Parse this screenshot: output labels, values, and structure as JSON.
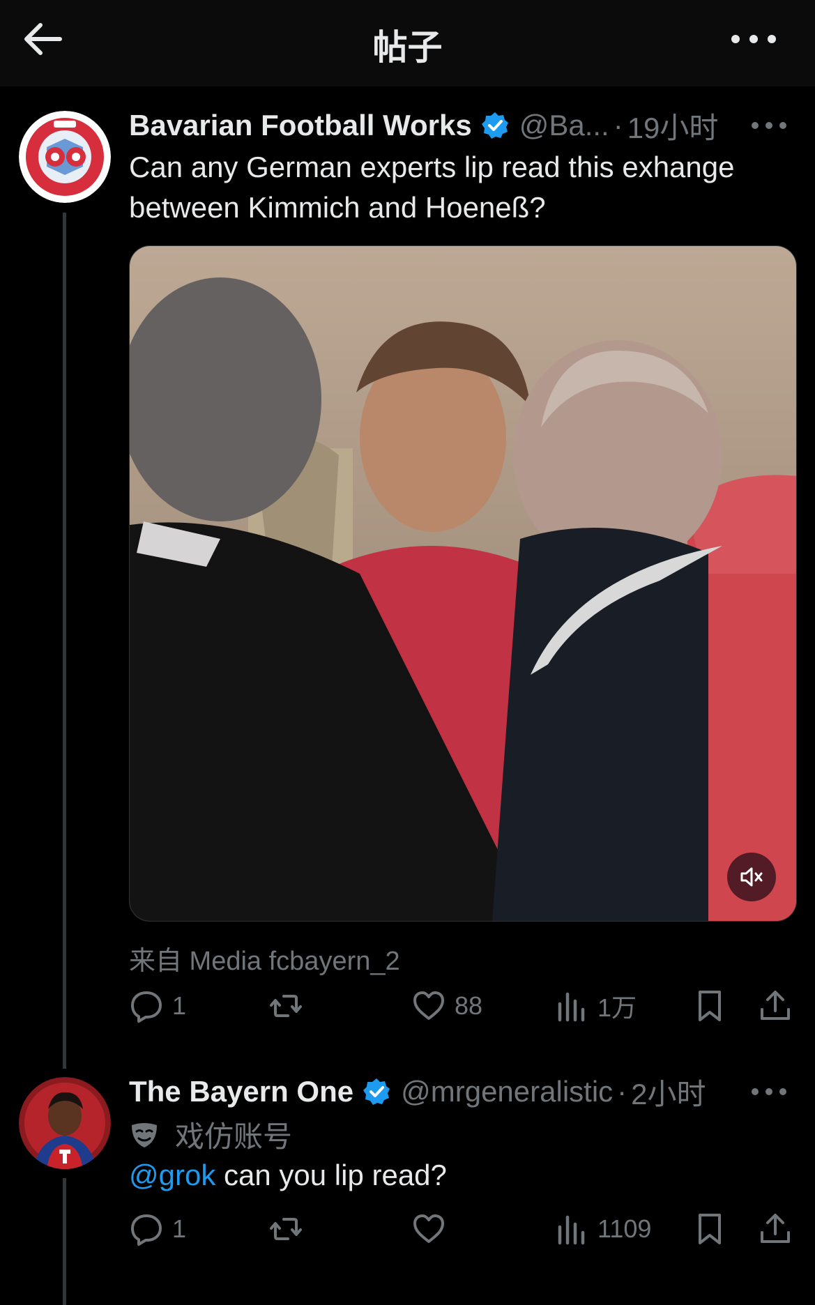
{
  "header": {
    "title": "帖子"
  },
  "main_post": {
    "author_name": "Bavarian Football Works",
    "handle": "@Ba...",
    "separator": "·",
    "time": "19小时",
    "text": "Can any German experts lip read this exhange between Kimmich and Hoeneß?",
    "media_source": "来自 Media fcbayern_2",
    "counts": {
      "replies": "1",
      "reposts": "",
      "likes": "88",
      "views": "1万"
    }
  },
  "reply_post": {
    "author_name": "The Bayern One",
    "handle": "@mrgeneralistic",
    "separator": "·",
    "time": "2小时",
    "parody_label": "戏仿账号",
    "mention": "@grok",
    "text": " can you lip read?",
    "counts": {
      "replies": "1",
      "reposts": "",
      "likes": "",
      "views": "1109"
    }
  },
  "colors": {
    "background": "#000000",
    "text": "#e7e9ea",
    "muted": "#71767b",
    "accent": "#1d9bf0"
  },
  "icons": [
    "back-arrow-icon",
    "more-icon",
    "verified-badge-icon",
    "mute-icon",
    "reply-icon",
    "repost-icon",
    "like-icon",
    "views-icon",
    "bookmark-icon",
    "share-icon",
    "parody-mask-icon"
  ]
}
